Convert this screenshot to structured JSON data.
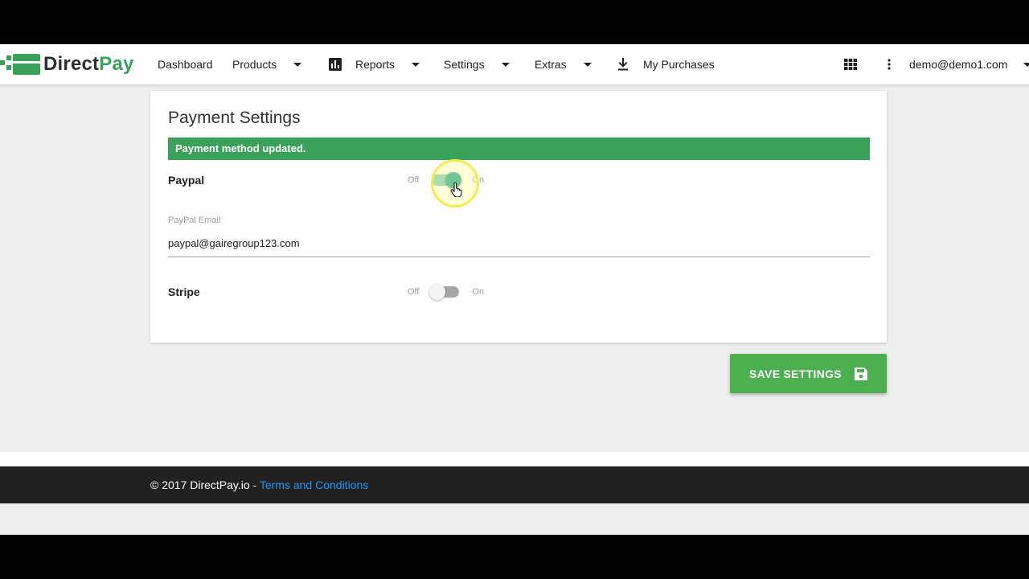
{
  "brand": {
    "name_part1": "Direct",
    "name_part2": "Pay",
    "green": "#3aa15a"
  },
  "nav": {
    "dashboard": "Dashboard",
    "products": "Products",
    "reports": "Reports",
    "settings": "Settings",
    "extras": "Extras",
    "my_purchases": "My Purchases",
    "user": "demo@demo1.com",
    "icons": [
      "bar-chart-icon",
      "download-icon",
      "apps-grid-icon",
      "more-vert-icon",
      "caret-down-icon"
    ]
  },
  "card": {
    "title": "Payment Settings",
    "alert": "Payment method updated.",
    "paypal": {
      "label": "Paypal",
      "off": "Off",
      "on": "On",
      "enabled": true,
      "email_label": "PayPal Email",
      "email_value": "paypal@gairegroup123.com"
    },
    "stripe": {
      "label": "Stripe",
      "off": "Off",
      "on": "On",
      "enabled": false
    }
  },
  "save_button": {
    "label": "SAVE SETTINGS",
    "icon": "save-icon",
    "color": "#4caf50"
  },
  "footer": {
    "copyright": "© 2017 DirectPay.io - ",
    "terms_link": "Terms and Conditions",
    "link_color": "#2196f3"
  }
}
